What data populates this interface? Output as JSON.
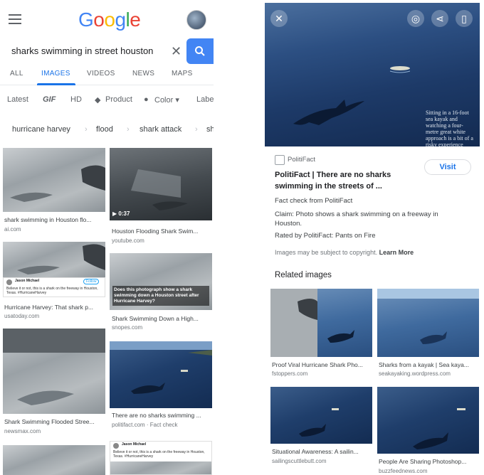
{
  "header": {
    "logo": "Google"
  },
  "search": {
    "query": "sharks swimming in street houston",
    "clear_glyph": "✕"
  },
  "tabs": [
    "ALL",
    "IMAGES",
    "VIDEOS",
    "NEWS",
    "MAPS"
  ],
  "filters": [
    "Latest",
    "GIF",
    "HD",
    "Product",
    "Color ▾",
    "Labe"
  ],
  "chips": [
    "hurricane harvey",
    "flood",
    "shark attack",
    "sh"
  ],
  "results": [
    {
      "caption": "shark swimming in Houston flo...",
      "source": "ai.com"
    },
    {
      "caption": "Houston Flooding Shark Swim...",
      "source": "youtube.com",
      "duration": "▶ 0:37"
    },
    {
      "caption": "Hurricane Harvey: That shark p...",
      "source": "usatoday.com"
    },
    {
      "caption": "Shark Swimming Down a High...",
      "source": "snopes.com"
    },
    {
      "caption": "Shark Swimming Flooded Stree...",
      "source": "newsmax.com"
    },
    {
      "caption": "There are no sharks swimming ...",
      "source": "politifact.com · Fact check"
    }
  ],
  "tweet_text": {
    "name": "Jason Michael",
    "body": "Believe it or not, this is a shark on the freeway in Houston, Texas. #HurricaneHarvey",
    "follow": "Follow"
  },
  "snopes_overlay": "Does this photograph show a shark swimming down a Houston street after Hurricane Harvey?",
  "hero_overlay": "Sitting in a 16-foot sea kayak and watching a four-metre great white approach is a bit of a risky experience",
  "detail": {
    "site": "PolitiFact",
    "title": "PolitiFact | There are no sharks swimming in the streets of ...",
    "visit_label": "Visit",
    "line1": "Fact check from PolitiFact",
    "line2": "Claim: Photo shows a shark swimming on a freeway in Houston.",
    "line3": "Rated by PolitiFact: Pants on Fire",
    "copyright": "Images may be subject to copyright.",
    "learn_more": "Learn More",
    "related_heading": "Related images"
  },
  "related": [
    {
      "caption": "Proof Viral Hurricane Shark Pho...",
      "source": "fstoppers.com"
    },
    {
      "caption": "Sharks from a kayak | Sea kaya...",
      "source": "seakayaking.wordpress.com"
    },
    {
      "caption": "Situational Awareness: A sailin...",
      "source": "sailingscuttlebutt.com"
    },
    {
      "caption": "People Are Sharing Photoshop...",
      "source": "buzzfeednews.com"
    }
  ],
  "colors": {
    "accent": "#1a73e8",
    "search_button": "#4285f4"
  }
}
